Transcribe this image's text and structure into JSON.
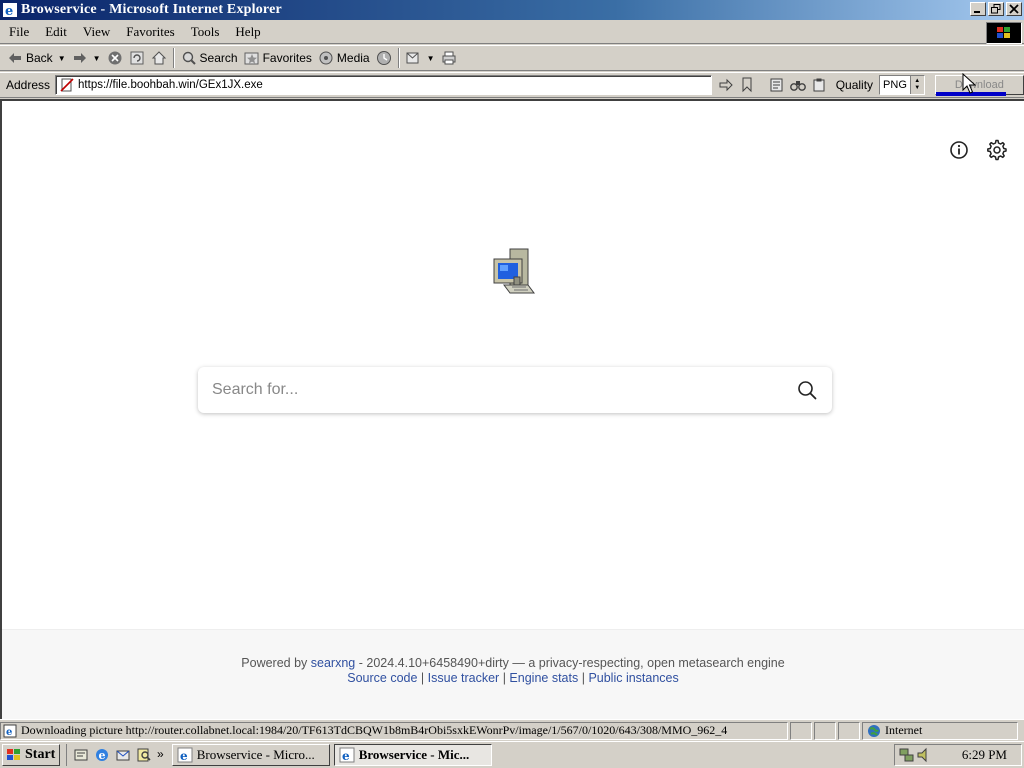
{
  "window": {
    "title": "Browservice - Microsoft Internet Explorer"
  },
  "menu": [
    "File",
    "Edit",
    "View",
    "Favorites",
    "Tools",
    "Help"
  ],
  "toolbar": {
    "back_label": "Back",
    "search_label": "Search",
    "favorites_label": "Favorites",
    "media_label": "Media"
  },
  "address": {
    "label": "Address",
    "url": "https://file.boohbah.win/GEx1JX.exe",
    "quality_label": "Quality",
    "quality_value": "PNG",
    "download_label": "Download",
    "download_progress": 0.8
  },
  "page": {
    "search_placeholder": "Search for...",
    "footer": {
      "powered_by": "Powered by",
      "engine_link": "searxng",
      "version_text": "- 2024.4.10+6458490+dirty — a privacy-respecting, open metasearch engine",
      "links": [
        "Source code",
        "Issue tracker",
        "Engine stats",
        "Public instances"
      ],
      "sep": "|"
    }
  },
  "status": {
    "text": "Downloading picture http://router.collabnet.local:1984/20/TF613TdCBQW1b8mB4rObi5sxkEWonrPv/image/1/567/0/1020/643/308/MMO_962_4",
    "zone": "Internet"
  },
  "taskbar": {
    "start_label": "Start",
    "tasks": [
      "Browservice - Micro...",
      "Browservice - Mic..."
    ],
    "clock": "6:29 PM"
  },
  "colors": {
    "title_gradient_start": "#0a246a",
    "title_gradient_end": "#a6caf0",
    "chrome": "#d4d0c8",
    "link": "#3050a0"
  }
}
